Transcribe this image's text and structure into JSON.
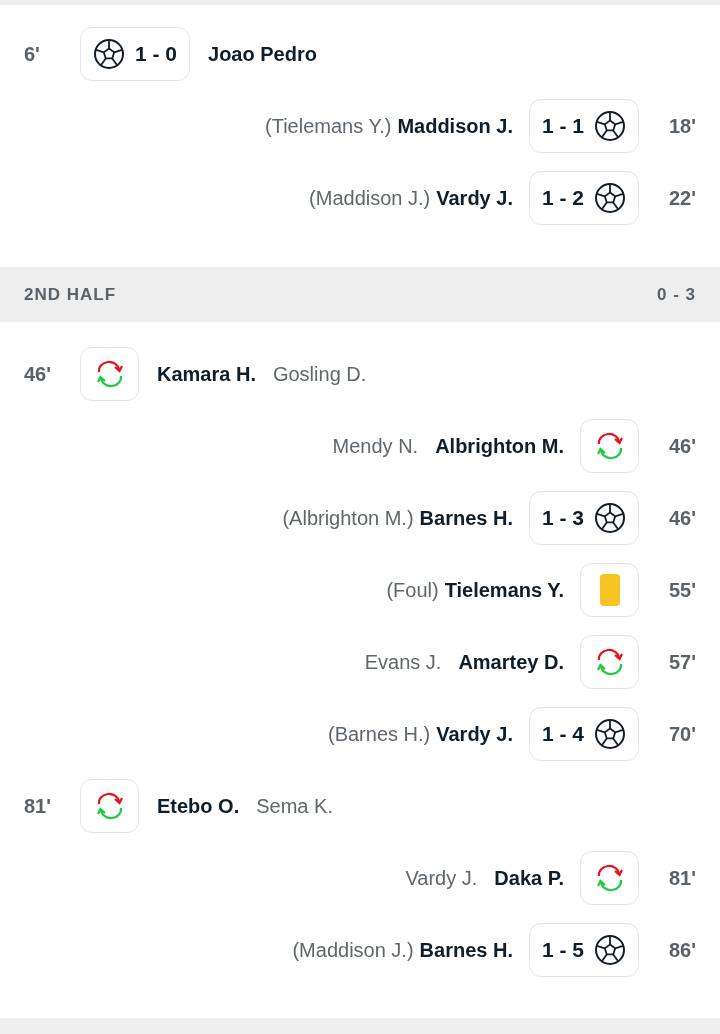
{
  "sections": [
    {
      "events": [
        {
          "away": false,
          "kind": "goal",
          "minute": "6'",
          "score": "1 - 0",
          "player": "Joao Pedro"
        },
        {
          "away": true,
          "kind": "goal",
          "minute": "18'",
          "score": "1 - 1",
          "player": "Maddison J.",
          "detail": "(Tielemans Y.)"
        },
        {
          "away": true,
          "kind": "goal",
          "minute": "22'",
          "score": "1 - 2",
          "player": "Vardy J.",
          "detail": "(Maddison J.)"
        }
      ]
    },
    {
      "header": {
        "title": "2ND HALF",
        "score": "0 - 3"
      },
      "events": [
        {
          "away": false,
          "kind": "substitution",
          "minute": "46'",
          "player": "Kamara H.",
          "detail": "Gosling D."
        },
        {
          "away": true,
          "kind": "substitution",
          "minute": "46'",
          "player": "Albrighton M.",
          "detail": "Mendy N."
        },
        {
          "away": true,
          "kind": "goal",
          "minute": "46'",
          "score": "1 - 3",
          "player": "Barnes H.",
          "detail": "(Albrighton M.)"
        },
        {
          "away": true,
          "kind": "booking",
          "minute": "55'",
          "player": "Tielemans Y.",
          "detail": "(Foul)"
        },
        {
          "away": true,
          "kind": "substitution",
          "minute": "57'",
          "player": "Amartey D.",
          "detail": "Evans J."
        },
        {
          "away": true,
          "kind": "goal",
          "minute": "70'",
          "score": "1 - 4",
          "player": "Vardy J.",
          "detail": "(Barnes H.)"
        },
        {
          "away": false,
          "kind": "substitution",
          "minute": "81'",
          "player": "Etebo O.",
          "detail": "Sema K."
        },
        {
          "away": true,
          "kind": "substitution",
          "minute": "81'",
          "player": "Daka P.",
          "detail": "Vardy J."
        },
        {
          "away": true,
          "kind": "goal",
          "minute": "86'",
          "score": "1 - 5",
          "player": "Barnes H.",
          "detail": "(Maddison J.)"
        }
      ]
    }
  ]
}
